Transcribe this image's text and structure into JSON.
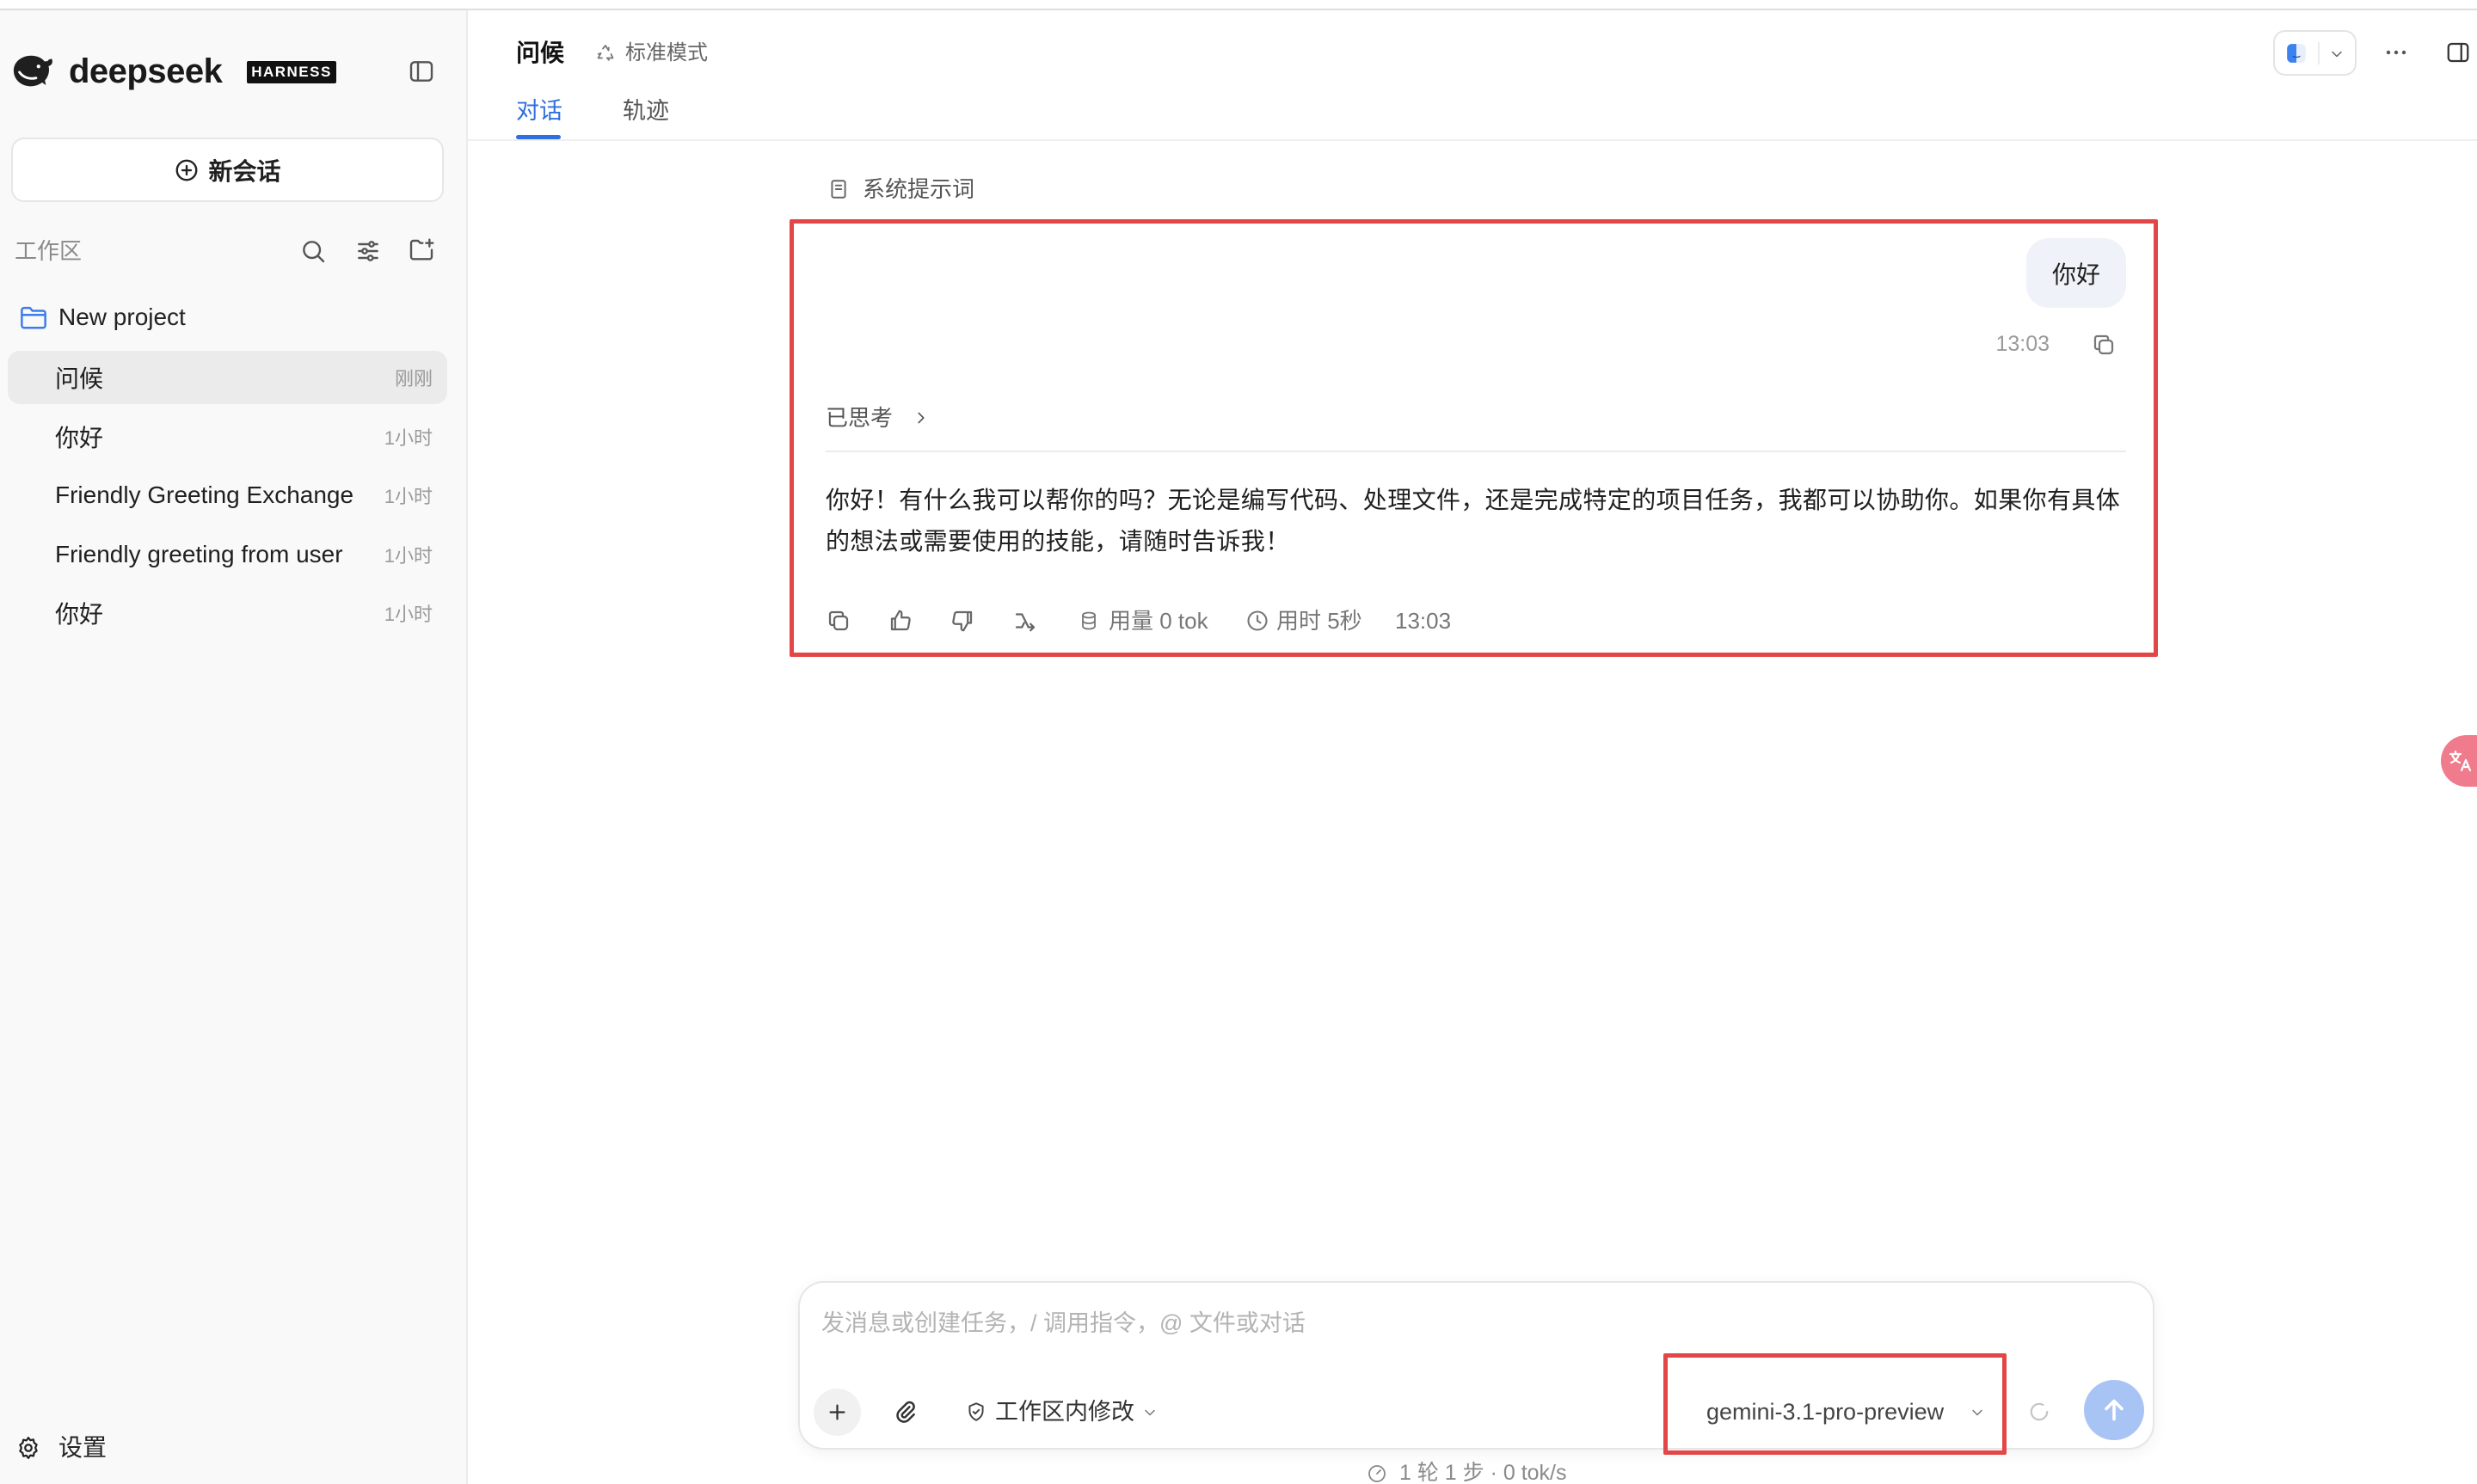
{
  "app": {
    "brand": "deepseek",
    "badge": "HARNESS"
  },
  "sidebar": {
    "new_chat_label": "新会话",
    "workspace_label": "工作区",
    "project_name": "New project",
    "conversations": [
      {
        "title": "问候",
        "time": "刚刚",
        "active": true
      },
      {
        "title": "你好",
        "time": "1小时",
        "active": false
      },
      {
        "title": "Friendly Greeting Exchange",
        "time": "1小时",
        "active": false
      },
      {
        "title": "Friendly greeting from user",
        "time": "1小时",
        "active": false
      },
      {
        "title": "你好",
        "time": "1小时",
        "active": false
      }
    ],
    "settings_label": "设置"
  },
  "header": {
    "title": "问候",
    "mode_label": "标准模式",
    "tabs": [
      {
        "label": "对话",
        "active": true
      },
      {
        "label": "轨迹",
        "active": false
      }
    ]
  },
  "chat": {
    "system_prompt_label": "系统提示词",
    "user_message": {
      "text": "你好",
      "time": "13:03"
    },
    "assistant_message": {
      "thinking_label": "已思考",
      "text": "你好！有什么我可以帮你的吗？无论是编写代码、处理文件，还是完成特定的项目任务，我都可以协助你。如果你有具体的想法或需要使用的技能，请随时告诉我！",
      "usage": "用量 0 tok",
      "duration": "用时 5秒",
      "time": "13:03"
    }
  },
  "composer": {
    "placeholder": "发消息或创建任务，/ 调用指令，@ 文件或对话",
    "permission_label": "工作区内修改",
    "model": "gemini-3.1-pro-preview"
  },
  "footer_stats": "1 轮 1 步 · 0 tok/s",
  "colors": {
    "accent": "#2f6fe0",
    "annotation_red": "#e34646",
    "send_button": "#a8c4f5",
    "project_folder": "#3b7ce8",
    "translate_badge": "#f07b8c"
  },
  "icons": [
    "whale-logo-icon",
    "sidebar-toggle-icon",
    "plus-circle-icon",
    "search-icon",
    "sliders-icon",
    "folder-plus-icon",
    "folder-icon",
    "gear-icon",
    "recycle-icon",
    "chevron-down-icon",
    "ellipsis-icon",
    "panel-right-icon",
    "document-icon",
    "copy-icon",
    "chevron-right-icon",
    "thumbs-up-icon",
    "thumbs-down-icon",
    "branch-icon",
    "database-icon",
    "clock-icon",
    "translate-icon",
    "plus-icon",
    "paperclip-icon",
    "shield-icon",
    "spinner-icon",
    "arrow-up-icon",
    "gauge-icon"
  ]
}
